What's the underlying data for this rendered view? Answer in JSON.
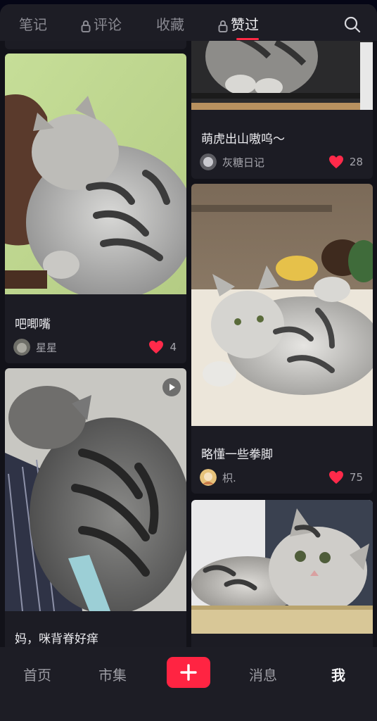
{
  "tabs": {
    "notes": "笔记",
    "comments": "评论",
    "favorites": "收藏",
    "liked": "赞过"
  },
  "left_column": [
    {
      "title": "吧唧嘴",
      "author": "星星",
      "likes": "4"
    },
    {
      "title": "妈，咪背脊好痒"
    }
  ],
  "right_column": [
    {
      "title": "萌虎出山嗷呜～",
      "author": "灰糖日记",
      "likes": "28"
    },
    {
      "title": "略懂一些拳脚",
      "author": "枳.",
      "likes": "75"
    }
  ],
  "bottom_nav": {
    "home": "首页",
    "market": "市集",
    "messages": "消息",
    "me": "我"
  },
  "colors": {
    "accent": "#ff2442",
    "heart": "#ff2a4a",
    "background": "#121219",
    "card": "#1c1c24"
  },
  "icons": [
    "lock-icon",
    "search-icon",
    "heart-icon",
    "play-icon",
    "plus-icon"
  ]
}
